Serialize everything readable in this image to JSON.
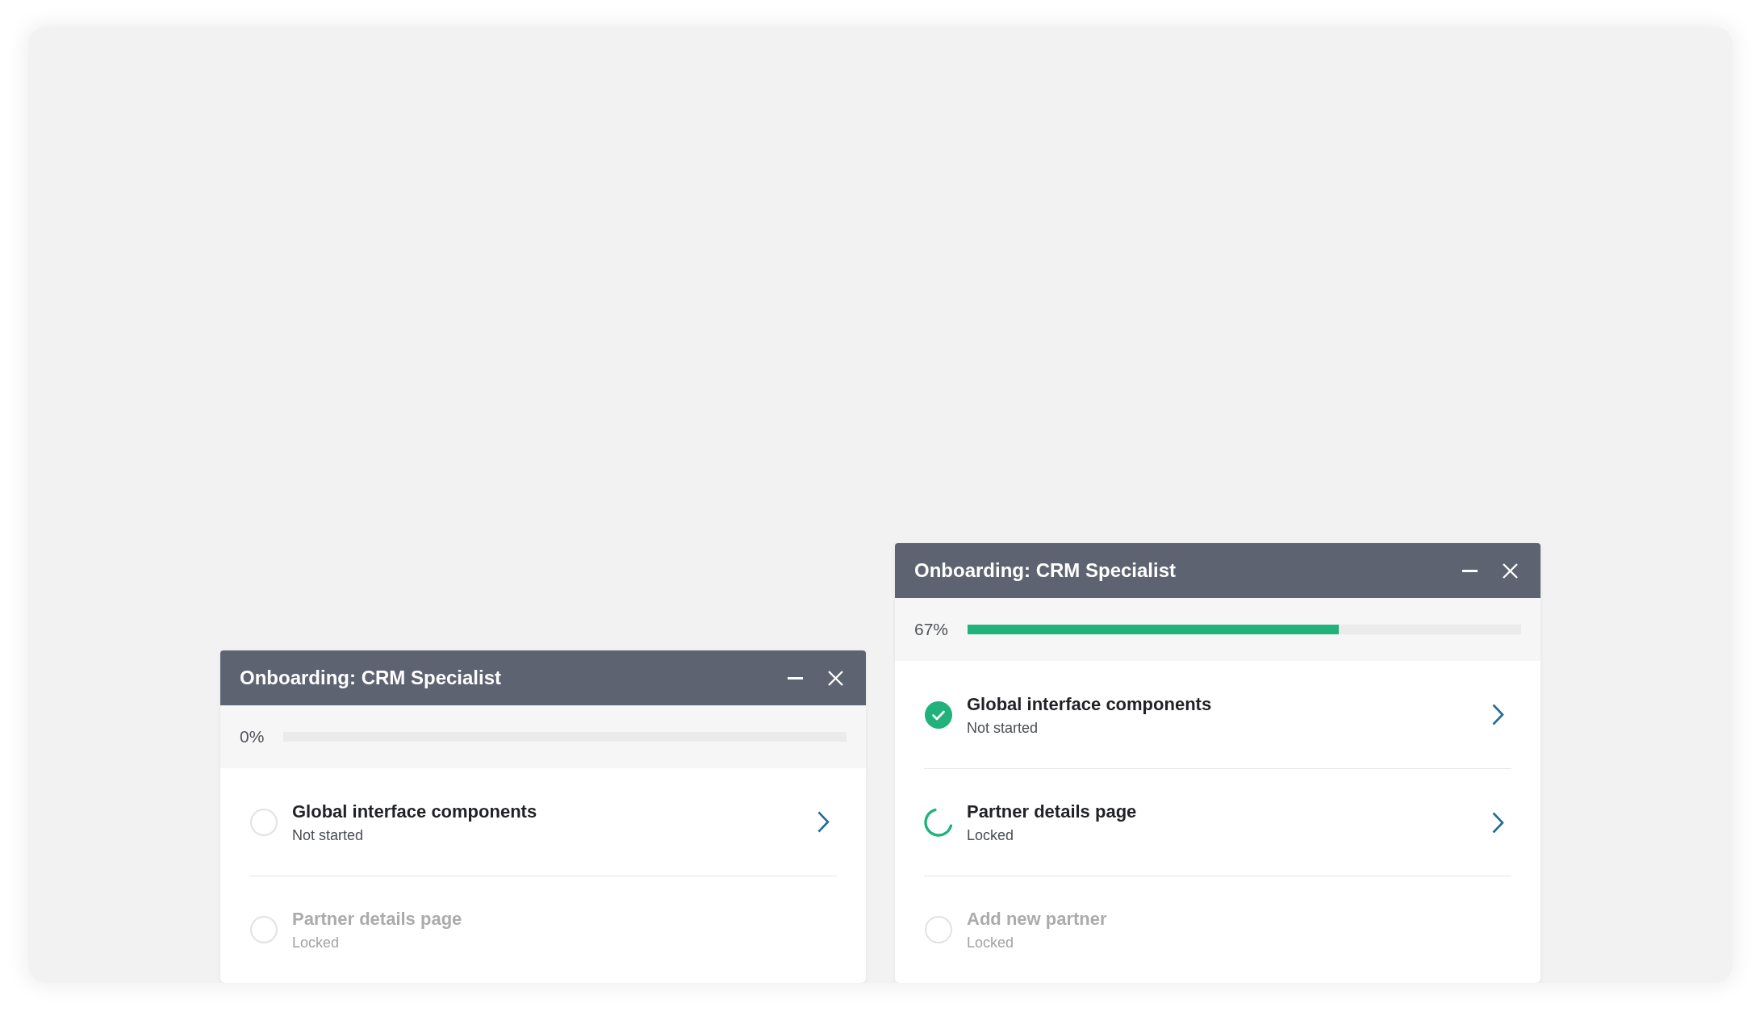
{
  "panels": [
    {
      "title": "Onboarding: CRM Specialist",
      "progress": {
        "label": "0%",
        "level": 0
      },
      "steps": [
        {
          "kind": "not_started",
          "title": "Global interface components",
          "status": "Not started",
          "disabled": false
        },
        {
          "kind": "not_started",
          "title": "Partner details page",
          "status": "Locked",
          "disabled": true
        }
      ]
    },
    {
      "title": "Onboarding: CRM Specialist",
      "progress": {
        "label": "67%",
        "level": 0.67
      },
      "steps": [
        {
          "kind": "done",
          "title": "Global interface components",
          "status": "Not started",
          "disabled": false
        },
        {
          "kind": "in_progress",
          "title": "Partner details page",
          "status": "Locked",
          "disabled": false
        },
        {
          "kind": "not_started",
          "title": "Add new partner",
          "status": "Locked",
          "disabled": true
        }
      ]
    }
  ]
}
